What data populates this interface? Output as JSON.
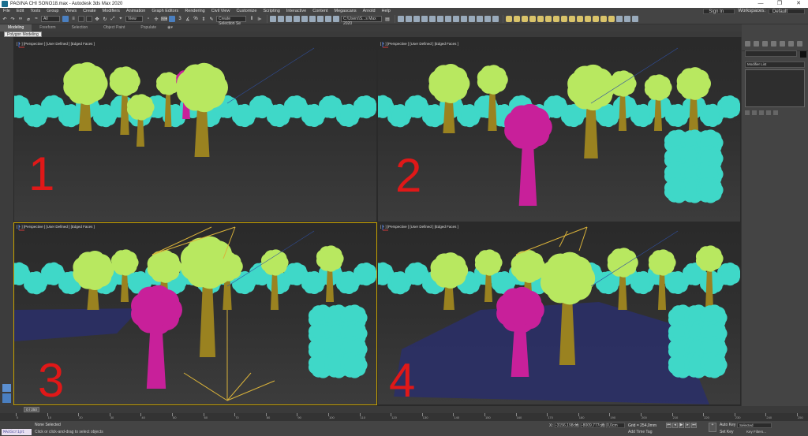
{
  "window": {
    "title": "PAGINA CHI SONO18.max - Autodesk 3ds Max 2020",
    "controls": [
      "—",
      "❐",
      "✕"
    ]
  },
  "menu": {
    "items": [
      "File",
      "Edit",
      "Tools",
      "Group",
      "Views",
      "Create",
      "Modifiers",
      "Animation",
      "Graph Editors",
      "Rendering",
      "Civil View",
      "Customize",
      "Scripting",
      "Interactive",
      "Content",
      "Megascans",
      "Arnold",
      "Help"
    ],
    "sign_in": "Sign In",
    "workspaces_label": "Workspaces:",
    "workspace_value": "Default"
  },
  "toolbar": {
    "filter_value": "All",
    "view_value": "View",
    "selection_set": "Create Selection Se",
    "path_value": "C:\\Users\\S...s Max 2020"
  },
  "ribbon": {
    "tabs": [
      "Modeling",
      "Freeform",
      "Selection",
      "Object Paint",
      "Populate"
    ],
    "active_tab": "Modeling",
    "tooltip": "Polygon Modeling"
  },
  "viewports": [
    {
      "label": "[ + ] [Perspective ] [User Defined ] [Edged Faces ]",
      "number": "1"
    },
    {
      "label": "[ + ] [Perspective ] [User Defined ] [Edged Faces ]",
      "number": "2"
    },
    {
      "label": "[ + ] [Perspective ] [User Defined ] [Edged Faces ]",
      "number": "3"
    },
    {
      "label": "[ + ] [Perspective ] [User Defined ] [Edged Faces ]",
      "number": "4"
    }
  ],
  "command_panel": {
    "modifier_list": "Modifier List"
  },
  "timeline": {
    "slider": "0 / 250",
    "ticks": [
      "0",
      "10",
      "20",
      "30",
      "40",
      "50",
      "60",
      "70",
      "80",
      "90",
      "100",
      "110",
      "120",
      "130",
      "140",
      "150",
      "160",
      "170",
      "180",
      "190",
      "200",
      "210",
      "220",
      "230",
      "240",
      "250"
    ]
  },
  "status": {
    "maxscript": "MAXScript Mini",
    "selection": "None Selected",
    "prompt": "Click or click-and-drag to select objects",
    "x_label": "X:",
    "x_value": "-3156,198cm",
    "y_label": "Y:",
    "y_value": "-8009,777cm",
    "z_label": "Z:",
    "z_value": "0,0cm",
    "grid": "Grid = 254,0mm",
    "add_time_tag": "Add Time Tag",
    "auto_key": "Auto Key",
    "selected": "Selected",
    "set_key": "Set Key",
    "key_filters": "Key Filters..."
  },
  "colors": {
    "cyan_foliage": "#3fd8c8",
    "green_foliage": "#b8e860",
    "magenta_tree": "#c8209a",
    "trunk": "#9a8220",
    "number_red": "#e01818",
    "active_border": "#c8a200",
    "ground_blue": "#2a2f6a"
  }
}
